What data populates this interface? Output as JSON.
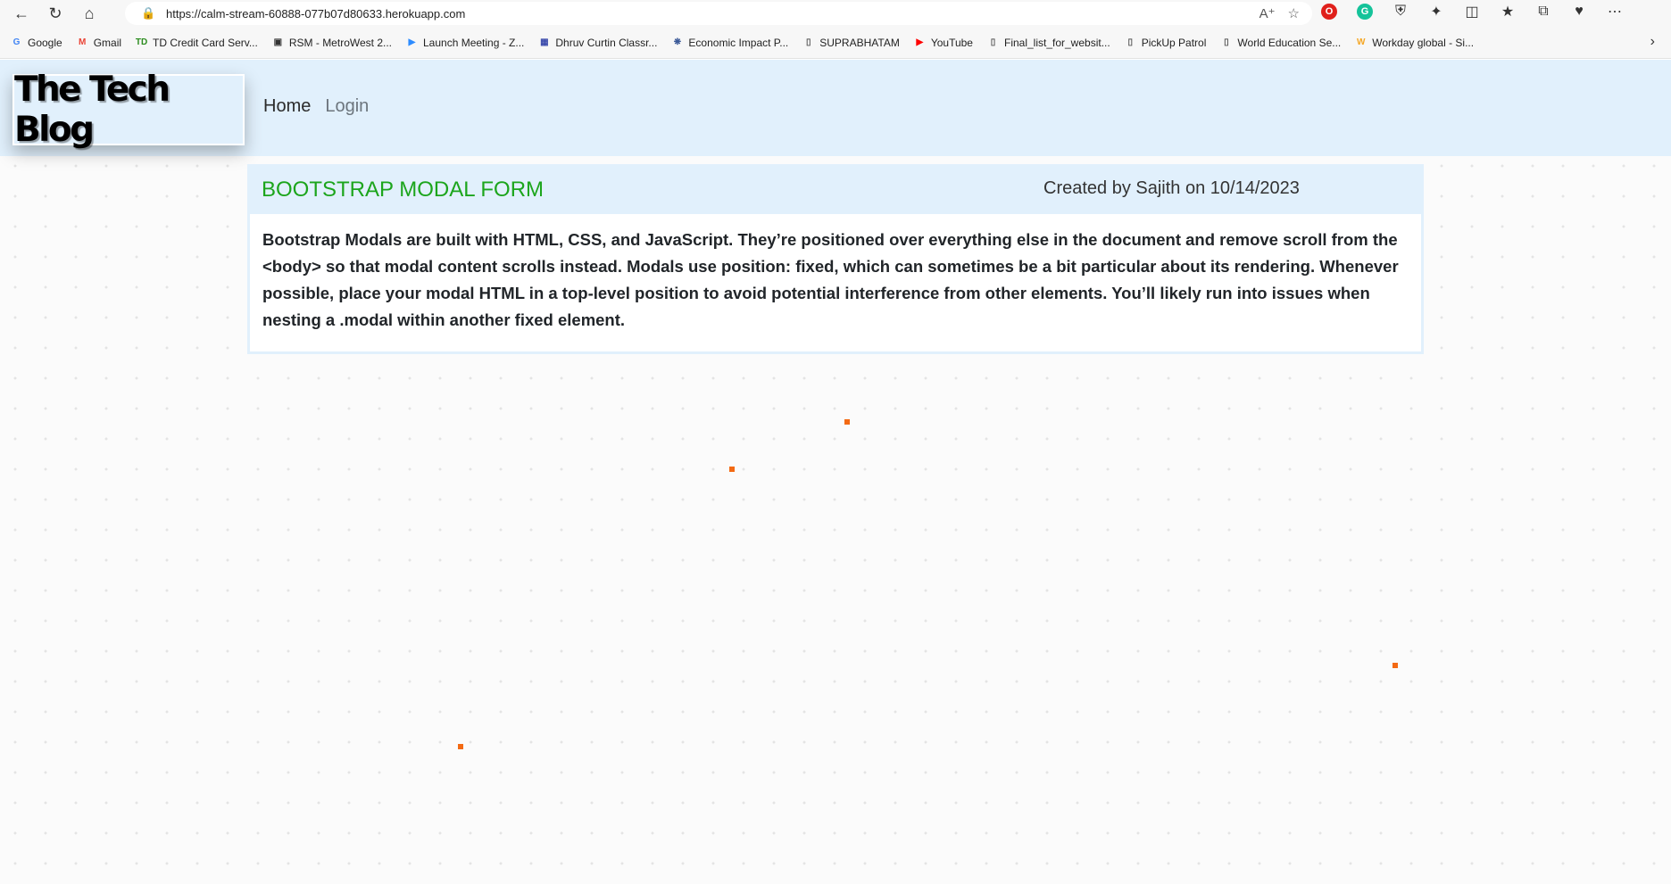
{
  "browser": {
    "url": "https://calm-stream-60888-077b07d80633.herokuapp.com",
    "bookmarks": [
      {
        "label": "Google",
        "icon": "google-icon",
        "color": "#4285f4"
      },
      {
        "label": "Gmail",
        "icon": "gmail-icon",
        "color": "#ea4335"
      },
      {
        "label": "TD Credit Card Serv...",
        "icon": "td-bank-icon",
        "color": "#2c8c1f"
      },
      {
        "label": "RSM - MetroWest 2...",
        "icon": "contact-card-icon",
        "color": "#333333"
      },
      {
        "label": "Launch Meeting - Z...",
        "icon": "zoom-icon",
        "color": "#2d8cff"
      },
      {
        "label": "Dhruv Curtin Classr...",
        "icon": "classroom-icon",
        "color": "#3949ab"
      },
      {
        "label": "Economic Impact P...",
        "icon": "seal-icon",
        "color": "#3b5998"
      },
      {
        "label": "SUPRABHATAM",
        "icon": "page-icon",
        "color": "#555555"
      },
      {
        "label": "YouTube",
        "icon": "youtube-icon",
        "color": "#ff0000"
      },
      {
        "label": "Final_list_for_websit...",
        "icon": "page-icon",
        "color": "#555555"
      },
      {
        "label": "PickUp Patrol",
        "icon": "page-icon",
        "color": "#555555"
      },
      {
        "label": "World Education Se...",
        "icon": "page-icon",
        "color": "#555555"
      },
      {
        "label": "Workday global - Si...",
        "icon": "workday-icon",
        "color": "#f5a623"
      }
    ]
  },
  "header": {
    "logo": "The Tech Blog",
    "nav": [
      {
        "label": "Home"
      },
      {
        "label": "Login"
      }
    ]
  },
  "post": {
    "title": "BOOTSTRAP MODAL FORM",
    "meta": "Created by Sajith on 10/14/2023",
    "body": "Bootstrap Modals are built with HTML, CSS, and JavaScript. They’re positioned over everything else in the document and remove scroll from the <body> so that modal content scrolls instead. Modals use position: fixed, which can sometimes be a bit particular about its rendering. Whenever possible, place your modal HTML in a top-level position to avoid potential interference from other elements. You’ll likely run into issues when nesting a .modal within another fixed element."
  },
  "colors": {
    "header_bg": "#e1f0fc",
    "title_green": "#1ca51c",
    "accent_orange": "#f36a14"
  }
}
